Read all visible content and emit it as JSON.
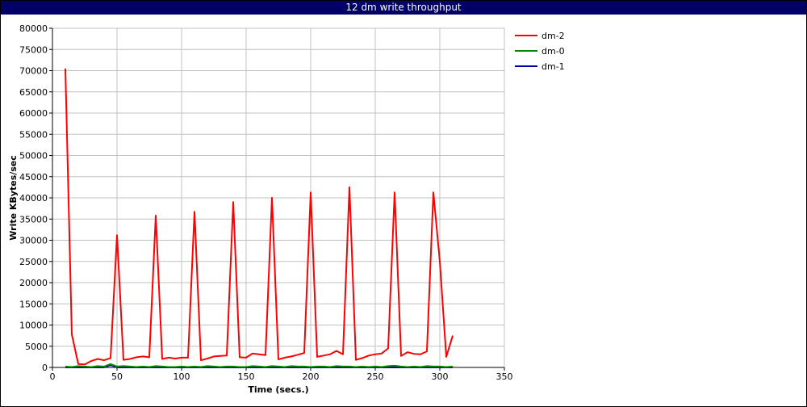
{
  "chart_data": {
    "type": "line",
    "title": "12 dm write throughput",
    "xlabel": "Time (secs.)",
    "ylabel": "Write KBytes/sec",
    "xlim": [
      0,
      350
    ],
    "ylim": [
      0,
      80000
    ],
    "x_ticks": [
      0,
      50,
      100,
      150,
      200,
      250,
      300,
      350
    ],
    "y_ticks": [
      0,
      5000,
      10000,
      15000,
      20000,
      25000,
      30000,
      35000,
      40000,
      45000,
      50000,
      55000,
      60000,
      65000,
      70000,
      75000,
      80000
    ],
    "grid": true,
    "legend_position": "right",
    "series": [
      {
        "name": "dm-2",
        "color": "#ff0000",
        "x": [
          10,
          15,
          20,
          25,
          30,
          35,
          40,
          45,
          50,
          55,
          60,
          65,
          70,
          75,
          80,
          85,
          90,
          95,
          100,
          105,
          110,
          115,
          120,
          125,
          130,
          135,
          140,
          145,
          150,
          155,
          160,
          165,
          170,
          175,
          180,
          185,
          190,
          195,
          200,
          205,
          210,
          215,
          220,
          225,
          230,
          235,
          240,
          245,
          250,
          255,
          260,
          265,
          270,
          275,
          280,
          285,
          290,
          295,
          300,
          305,
          310
        ],
        "y": [
          70500,
          7800,
          800,
          700,
          1500,
          2000,
          1700,
          2200,
          31200,
          1800,
          2000,
          2400,
          2600,
          2400,
          35800,
          2000,
          2300,
          2100,
          2300,
          2300,
          36700,
          1700,
          2100,
          2600,
          2700,
          2800,
          39000,
          2400,
          2300,
          3300,
          3100,
          2900,
          40000,
          1900,
          2300,
          2600,
          3000,
          3400,
          41300,
          2500,
          2800,
          3100,
          3900,
          3100,
          42500,
          1800,
          2200,
          2800,
          3100,
          3300,
          4500,
          41300,
          2700,
          3600,
          3200,
          3100,
          3800,
          41300,
          25000,
          2500,
          7500
        ]
      },
      {
        "name": "dm-0",
        "color": "#008800",
        "x": [
          10,
          15,
          20,
          25,
          30,
          35,
          40,
          45,
          50,
          55,
          60,
          65,
          70,
          75,
          80,
          85,
          90,
          95,
          100,
          105,
          110,
          115,
          120,
          125,
          130,
          135,
          140,
          145,
          150,
          155,
          160,
          165,
          170,
          175,
          180,
          185,
          190,
          195,
          200,
          205,
          210,
          215,
          220,
          225,
          230,
          235,
          240,
          245,
          250,
          255,
          260,
          265,
          270,
          275,
          280,
          285,
          290,
          295,
          300,
          305,
          310
        ],
        "y": [
          200,
          100,
          300,
          200,
          100,
          300,
          200,
          800,
          200,
          300,
          200,
          100,
          200,
          100,
          300,
          200,
          100,
          100,
          200,
          100,
          200,
          100,
          300,
          200,
          100,
          200,
          200,
          100,
          100,
          300,
          200,
          100,
          300,
          200,
          100,
          300,
          200,
          200,
          100,
          200,
          200,
          100,
          300,
          200,
          200,
          100,
          200,
          100,
          200,
          100,
          300,
          400,
          200,
          100,
          200,
          100,
          300,
          200,
          200,
          100,
          200
        ]
      },
      {
        "name": "dm-1",
        "color": "#0000aa",
        "x": [
          10,
          20,
          30,
          40,
          45,
          50,
          60,
          80,
          100,
          150,
          200,
          250,
          300,
          310
        ],
        "y": [
          0,
          0,
          0,
          0,
          600,
          0,
          0,
          0,
          0,
          0,
          0,
          0,
          0,
          0
        ]
      }
    ]
  }
}
